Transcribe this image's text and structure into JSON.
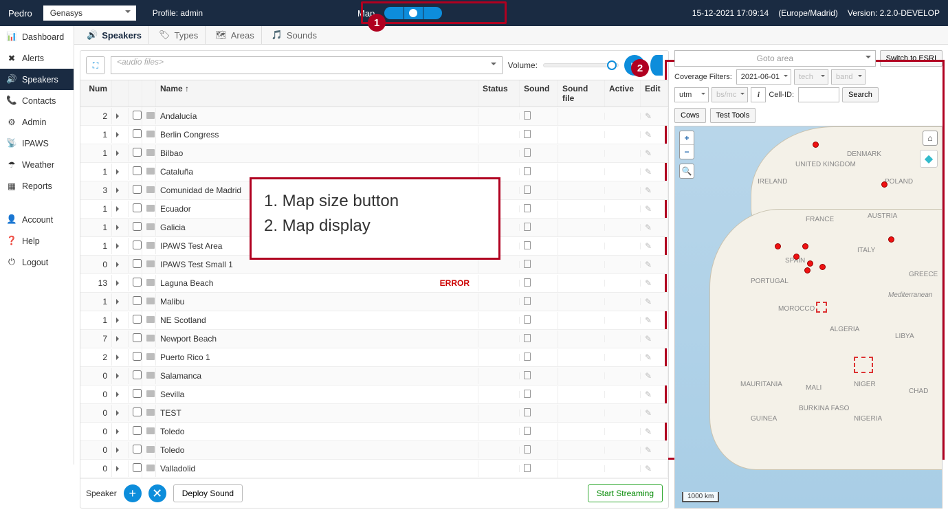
{
  "topbar": {
    "user": "Pedro",
    "org": "Genasys",
    "profile": "Profile: admin",
    "map_label": "Map",
    "datetime": "15-12-2021 17:09:14",
    "tz": "(Europe/Madrid)",
    "version": "Version: 2.2.0-DEVELOP"
  },
  "sidebar": [
    {
      "icon": "bar-chart-icon",
      "label": "Dashboard"
    },
    {
      "icon": "x-icon",
      "label": "Alerts"
    },
    {
      "icon": "speaker-icon",
      "label": "Speakers",
      "active": true
    },
    {
      "icon": "phone-icon",
      "label": "Contacts"
    },
    {
      "icon": "gear-icon",
      "label": "Admin"
    },
    {
      "icon": "broadcast-icon",
      "label": "IPAWS"
    },
    {
      "icon": "umbrella-icon",
      "label": "Weather"
    },
    {
      "icon": "grid-icon",
      "label": "Reports"
    },
    {
      "sep": true
    },
    {
      "icon": "user-icon",
      "label": "Account"
    },
    {
      "icon": "help-icon",
      "label": "Help"
    },
    {
      "icon": "power-icon",
      "label": "Logout"
    }
  ],
  "tabs": [
    {
      "icon": "speaker-icon",
      "label": "Speakers",
      "active": true
    },
    {
      "icon": "tag-icon",
      "label": "Types"
    },
    {
      "icon": "sitemap-icon",
      "label": "Areas"
    },
    {
      "icon": "note-icon",
      "label": "Sounds"
    }
  ],
  "toolbar": {
    "audio_placeholder": "<audio files>",
    "volume_label": "Volume:"
  },
  "columns": {
    "num": "Num",
    "name": "Name ↑",
    "status": "Status",
    "sound": "Sound",
    "sfile": "Sound file",
    "active": "Active",
    "edit": "Edit"
  },
  "rows": [
    {
      "num": "2",
      "name": "Andalucía"
    },
    {
      "num": "1",
      "name": "Berlin Congress"
    },
    {
      "num": "1",
      "name": "Bilbao"
    },
    {
      "num": "1",
      "name": "Cataluña"
    },
    {
      "num": "3",
      "name": "Comunidad de Madrid"
    },
    {
      "num": "1",
      "name": "Ecuador"
    },
    {
      "num": "1",
      "name": "Galicia"
    },
    {
      "num": "1",
      "name": "IPAWS Test Area"
    },
    {
      "num": "0",
      "name": "IPAWS Test Small 1"
    },
    {
      "num": "13",
      "name": "Laguna Beach",
      "status": "ERROR"
    },
    {
      "num": "1",
      "name": "Malibu"
    },
    {
      "num": "1",
      "name": "NE Scotland"
    },
    {
      "num": "7",
      "name": "Newport Beach"
    },
    {
      "num": "2",
      "name": "Puerto Rico 1"
    },
    {
      "num": "0",
      "name": "Salamanca"
    },
    {
      "num": "0",
      "name": "Sevilla"
    },
    {
      "num": "0",
      "name": "TEST"
    },
    {
      "num": "0",
      "name": "Toledo"
    },
    {
      "num": "0",
      "name": "Toledo"
    },
    {
      "num": "0",
      "name": "Valladolid"
    }
  ],
  "footer": {
    "speaker": "Speaker",
    "deploy": "Deploy Sound",
    "start": "Start Streaming"
  },
  "map": {
    "goto": "Goto area",
    "switch": "Switch to ESRI",
    "cov_label": "Coverage Filters:",
    "date": "2021-06-01",
    "tech": "tech",
    "band": "band",
    "utm": "utm",
    "bsmc": "bs/mc",
    "cell_label": "Cell-ID:",
    "search": "Search",
    "cows": "Cows",
    "tools": "Test Tools",
    "scale": "1000 km",
    "labels": [
      "UNITED KINGDOM",
      "IRELAND",
      "DENMARK",
      "POLAND",
      "FRANCE",
      "AUSTRIA",
      "SPAIN",
      "ITALY",
      "PORTUGAL",
      "GREECE",
      "Mediterranean",
      "MOROCCO",
      "ALGERIA",
      "LIBYA",
      "MAURITANIA",
      "MALI",
      "NIGER",
      "CHAD",
      "GUINEA",
      "BURKINA FASO",
      "NIGERIA"
    ]
  },
  "legend": {
    "l1": "1. Map size button",
    "l2": "2. Map display"
  },
  "callouts": {
    "c1": "1",
    "c2": "2"
  }
}
